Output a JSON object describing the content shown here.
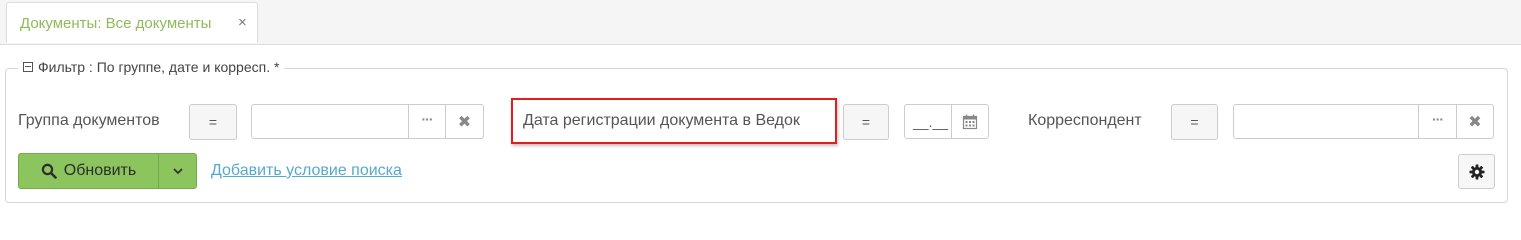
{
  "tabs": [
    {
      "label": "Документы: Все документы",
      "close_symbol": "×"
    }
  ],
  "filter": {
    "legend": "Фильтр : По группе, дате и корресп. *",
    "fields": [
      {
        "label": "Группа документов",
        "operator": "=",
        "value": "",
        "browse_symbol": "···",
        "clear_symbol": "✖"
      },
      {
        "label": "Дата регистрации документа в Ведок",
        "operator": "=",
        "value": "__.__",
        "highlighted": true
      },
      {
        "label": "Корреспондент",
        "operator": "=",
        "value": "",
        "browse_symbol": "···",
        "clear_symbol": "✖"
      }
    ]
  },
  "actions": {
    "refresh_label": "Обновить",
    "add_condition_link": "Добавить условие поиска"
  },
  "colors": {
    "tab_text": "#8dbb5a",
    "refresh_button": "#8cc45e",
    "link": "#55aacc",
    "highlight_border": "#e01e1e"
  },
  "icons": [
    "close-icon",
    "collapse-icon",
    "ellipsis-icon",
    "clear-icon",
    "calendar-icon",
    "search-icon",
    "chevron-down-icon",
    "gear-icon"
  ]
}
